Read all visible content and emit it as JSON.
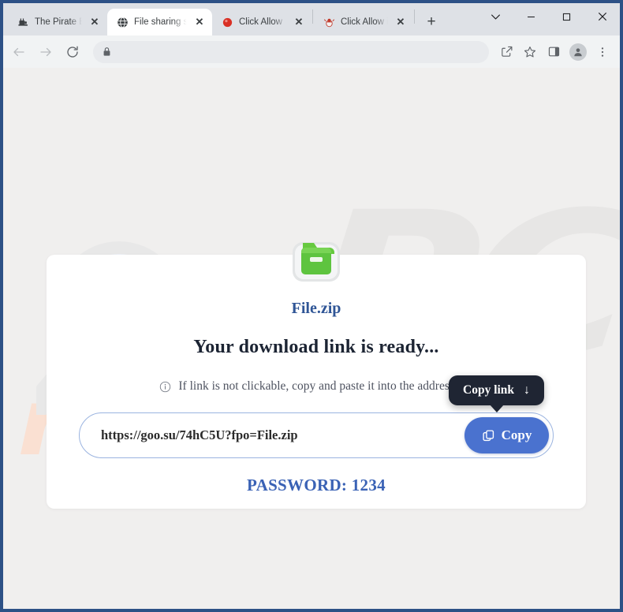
{
  "browser": {
    "tabs": [
      {
        "title": "The Pirate Bay",
        "favicon": "ship-icon",
        "active": false,
        "close_label": "✕"
      },
      {
        "title": "File sharing se",
        "favicon": "globe-icon",
        "active": true,
        "close_label": "✕"
      },
      {
        "title": "Click Allow",
        "favicon": "red-dot-icon",
        "active": false,
        "close_label": "✕"
      },
      {
        "title": "Click Allow if y",
        "favicon": "bug-icon",
        "active": false,
        "close_label": "✕"
      }
    ],
    "new_tab_label": "+",
    "window_controls": {
      "tab_search": "tab-search-icon",
      "minimize": "minimize-icon",
      "maximize": "maximize-icon",
      "close": "window-close-icon"
    },
    "toolbar": {
      "back": "back-arrow-icon",
      "forward": "forward-arrow-icon",
      "reload": "reload-icon",
      "lock": "lock-icon",
      "url": "",
      "url_placeholder": "",
      "share": "share-icon",
      "bookmark": "star-icon",
      "side_panel": "side-panel-icon",
      "profile": "profile-avatar-icon",
      "menu": "three-dot-menu-icon"
    }
  },
  "page": {
    "watermark_pc": "PC",
    "watermark_risk": "risk.com",
    "file_icon": "green-zip-folder-icon",
    "file_name": "File.zip",
    "headline": "Your download link is ready...",
    "hint_icon": "info-circle-icon",
    "hint_text": "If link is not clickable, copy and paste it into the address bar",
    "link_url": "https://goo.su/74hC5U?fpo=File.zip",
    "copy_button": {
      "label": "Copy",
      "icon": "copy-icon"
    },
    "password": "PASSWORD: 1234",
    "tooltip": {
      "label": "Copy link",
      "arrow": "↓"
    },
    "colors": {
      "accent_blue": "#4a72cf",
      "link_blue": "#2f5596",
      "password_blue": "#3a62b5",
      "tooltip_bg": "#1f2533",
      "zip_green": "#5ec43f",
      "watermark_pink": "#fae0d2",
      "watermark_gray": "#e7e6e5",
      "frame_blue": "#2d5186"
    }
  }
}
